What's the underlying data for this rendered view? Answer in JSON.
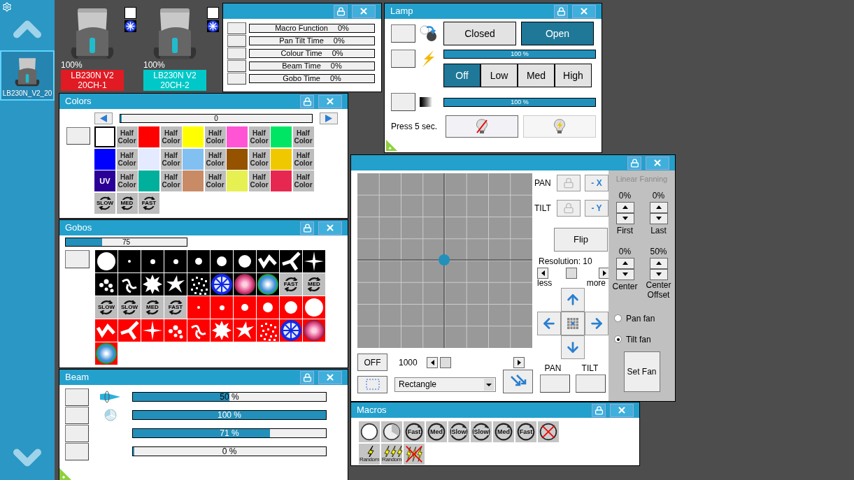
{
  "sidebar": {
    "thumbnail_label": "LB230N_V2_20",
    "selected": true
  },
  "fixtures": [
    {
      "percent": "100%",
      "name": "LB230N V2",
      "channel": "20CH-1",
      "color": "#e01b24"
    },
    {
      "percent": "100%",
      "name": "LB230N V2",
      "channel": "20CH-2",
      "color": "#00c8c8"
    }
  ],
  "function_window": {
    "rows": [
      {
        "label": "Macro Function",
        "value": "0%"
      },
      {
        "label": "Pan Tilt Time",
        "value": "0%"
      },
      {
        "label": "Colour Time",
        "value": "0%"
      },
      {
        "label": "Beam Time",
        "value": "0%"
      },
      {
        "label": "Gobo Time",
        "value": "0%"
      }
    ]
  },
  "colors": {
    "title": "Colors",
    "slider": {
      "value": "0",
      "level": 0
    },
    "items": [
      {
        "kind": "color",
        "color": "#ffffff",
        "selected": true
      },
      {
        "kind": "half",
        "label": "Half Color"
      },
      {
        "kind": "color",
        "color": "#ff0000",
        "selected": false
      },
      {
        "kind": "half",
        "label": "Half Color"
      },
      {
        "kind": "color",
        "color": "#ffff00",
        "selected": false
      },
      {
        "kind": "half",
        "label": "Half Color"
      },
      {
        "kind": "color",
        "color": "#ff55d4",
        "selected": false
      },
      {
        "kind": "half",
        "label": "Half Color"
      },
      {
        "kind": "color",
        "color": "#00e664",
        "selected": false
      },
      {
        "kind": "half",
        "label": "Half Color"
      },
      {
        "kind": "color",
        "color": "#0000ff",
        "selected": false
      },
      {
        "kind": "half",
        "label": "Half Color"
      },
      {
        "kind": "color",
        "color": "#e4eaff",
        "selected": false
      },
      {
        "kind": "half",
        "label": "Half Color"
      },
      {
        "kind": "color",
        "color": "#82c0f2",
        "selected": false
      },
      {
        "kind": "half",
        "label": "Half Color"
      },
      {
        "kind": "color",
        "color": "#955300",
        "selected": false
      },
      {
        "kind": "half",
        "label": "Half Color"
      },
      {
        "kind": "color",
        "color": "#f0c800",
        "selected": false
      },
      {
        "kind": "half",
        "label": "Half Color"
      },
      {
        "kind": "uv",
        "label": "UV",
        "color": "#2a0096"
      },
      {
        "kind": "half",
        "label": "Half Color"
      },
      {
        "kind": "color",
        "color": "#00b09c",
        "selected": false
      },
      {
        "kind": "half",
        "label": "Half Color"
      },
      {
        "kind": "color",
        "color": "#c98b66",
        "selected": false
      },
      {
        "kind": "half",
        "label": "Half Color"
      },
      {
        "kind": "color",
        "color": "#e6f050",
        "selected": false
      },
      {
        "kind": "half",
        "label": "Half Color"
      },
      {
        "kind": "color",
        "color": "#e62850",
        "selected": false
      },
      {
        "kind": "half",
        "label": "Half Color"
      },
      {
        "kind": "speed",
        "label": "SLOW"
      },
      {
        "kind": "speed",
        "label": "MED"
      },
      {
        "kind": "speed",
        "label": "FAST"
      }
    ]
  },
  "gobos": {
    "title": "Gobos",
    "level": 0.3,
    "reading": "75",
    "items": [
      {
        "kind": "open",
        "color": "#000000"
      },
      {
        "kind": "pinhole",
        "color": "#000000"
      },
      {
        "kind": "small",
        "color": "#000000"
      },
      {
        "kind": "small",
        "color": "#000000"
      },
      {
        "kind": "medium",
        "color": "#000000"
      },
      {
        "kind": "large",
        "color": "#000000"
      },
      {
        "kind": "huge",
        "color": "#000000"
      },
      {
        "kind": "zigzag",
        "color": "#000000"
      },
      {
        "kind": "tripod",
        "color": "#000000"
      },
      {
        "kind": "cross",
        "color": "#000000"
      },
      {
        "kind": "bubbles",
        "color": "#000000"
      },
      {
        "kind": "swirl",
        "color": "#000000"
      },
      {
        "kind": "burst",
        "color": "#000000"
      },
      {
        "kind": "splat",
        "color": "#000000"
      },
      {
        "kind": "scatter",
        "color": "#000000"
      },
      {
        "kind": "wheel",
        "color": "#000000"
      },
      {
        "kind": "flower",
        "color": "#000000"
      },
      {
        "kind": "glow",
        "color": "#000000"
      },
      {
        "kind": "speed",
        "label": "FAST"
      },
      {
        "kind": "speed",
        "label": "MED"
      },
      {
        "kind": "speed",
        "label": "SLOW"
      },
      {
        "kind": "speed",
        "label": "SLOW"
      },
      {
        "kind": "speed",
        "label": "MED"
      },
      {
        "kind": "speed",
        "label": "FAST"
      },
      {
        "kind": "pinhole",
        "color": "#ff0000"
      },
      {
        "kind": "small",
        "color": "#ff0000"
      },
      {
        "kind": "medium",
        "color": "#ff0000"
      },
      {
        "kind": "large",
        "color": "#ff0000"
      },
      {
        "kind": "huge",
        "color": "#ff0000"
      },
      {
        "kind": "open",
        "color": "#ff0000"
      },
      {
        "kind": "zigzag",
        "color": "#ff0000"
      },
      {
        "kind": "tripod",
        "color": "#ff0000"
      },
      {
        "kind": "cross",
        "color": "#ff0000"
      },
      {
        "kind": "bubbles",
        "color": "#ff0000"
      },
      {
        "kind": "swirl",
        "color": "#ff0000"
      },
      {
        "kind": "burst",
        "color": "#ff0000"
      },
      {
        "kind": "splat",
        "color": "#ff0000"
      },
      {
        "kind": "scatter",
        "color": "#ff0000"
      },
      {
        "kind": "wheel",
        "color": "#ff0000"
      },
      {
        "kind": "flower",
        "color": "#ff0000"
      },
      {
        "kind": "glow",
        "color": "#ff0000"
      }
    ]
  },
  "beam": {
    "title": "Beam",
    "rows": [
      {
        "kind": "zoom",
        "level": 0.5,
        "reading": "50 %"
      },
      {
        "kind": "prism",
        "level": 1,
        "reading": "100 %"
      },
      {
        "kind": "plain",
        "level": 0.71,
        "reading": "71 %"
      },
      {
        "kind": "plain",
        "level": 0,
        "reading": "0 %"
      }
    ]
  },
  "lamp": {
    "title": "Lamp",
    "shutter": [
      {
        "label": "Closed",
        "selected": false
      },
      {
        "label": "Open",
        "selected": true
      }
    ],
    "dimmer": {
      "level": 1,
      "reading": "100 %"
    },
    "strobe": [
      {
        "label": "Off",
        "selected": true
      },
      {
        "label": "Low",
        "selected": false
      },
      {
        "label": "Med",
        "selected": false
      },
      {
        "label": "High",
        "selected": false
      }
    ],
    "level_bar": {
      "level": 1,
      "reading": "100 %"
    },
    "reset_label": "Press 5 sec."
  },
  "position": {
    "pan_label": "PAN",
    "tilt_label": "TILT",
    "invert_x": "- X",
    "invert_y": "- Y",
    "flip": "Flip",
    "resolution": "Resolution: 10",
    "resolution_slider": {
      "level": 0.45
    },
    "less": "less",
    "more": "more",
    "effect_toggle": "OFF",
    "speed": "1000",
    "speed_slider": {
      "level": 0.03
    },
    "shape": "Rectangle",
    "pan_button_label": "PAN",
    "tilt_button_label": "TILT",
    "fanning": {
      "title": "Linear Fanning",
      "first_value": "0%",
      "last_value": "0%",
      "first": "First",
      "last": "Last",
      "center_value": "0%",
      "offset_value": "50%",
      "center": "Center",
      "offset": "Center Offset",
      "modes": [
        {
          "label": "Pan fan",
          "selected": false
        },
        {
          "label": "Tilt fan",
          "selected": true
        }
      ],
      "set": "Set Fan"
    }
  },
  "macros": {
    "title": "Macros",
    "items": [
      {
        "kind": "open"
      },
      {
        "kind": "half"
      },
      {
        "kind": "spin",
        "label": "Fast"
      },
      {
        "kind": "spin",
        "label": "Med"
      },
      {
        "kind": "spin",
        "label": "Slow"
      },
      {
        "kind": "spin",
        "label": "Slow"
      },
      {
        "kind": "spin",
        "label": "Med"
      },
      {
        "kind": "spin",
        "label": "Fast"
      },
      {
        "kind": "stop"
      },
      {
        "kind": "random",
        "label": "Random"
      },
      {
        "kind": "random3",
        "label": "Random"
      },
      {
        "kind": "strobe-off"
      }
    ]
  }
}
